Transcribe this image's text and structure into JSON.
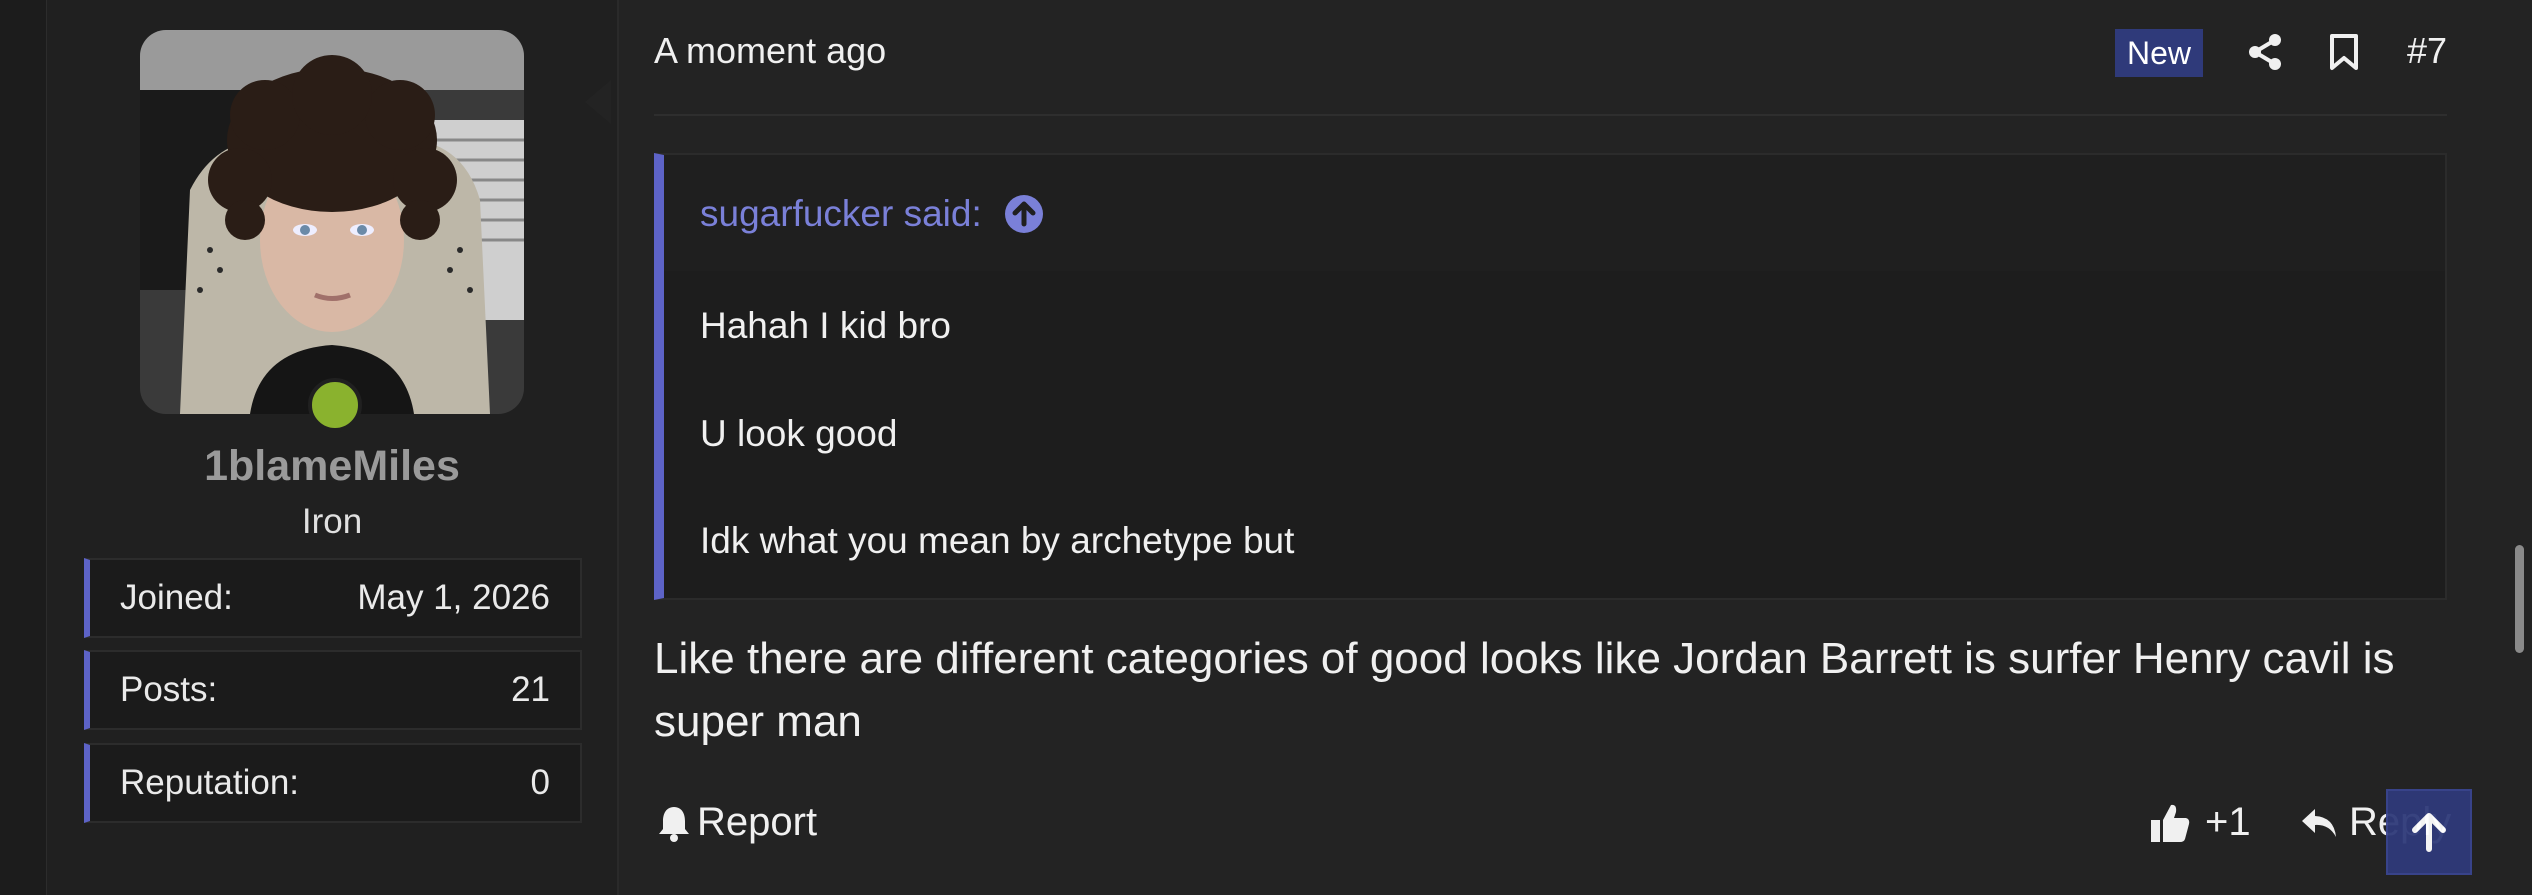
{
  "user": {
    "name": "1blameMiles",
    "rank": "Iron",
    "online": true,
    "stats": [
      {
        "label": "Joined:",
        "value": "May 1, 2026"
      },
      {
        "label": "Posts:",
        "value": "21"
      },
      {
        "label": "Reputation:",
        "value": "0"
      }
    ]
  },
  "post": {
    "time": "A moment ago",
    "badge": "New",
    "number": "#7",
    "quote": {
      "author": "sugarfucker said:",
      "lines": [
        "Hahah I kid bro",
        "U look good",
        "Idk what you mean by archetype but"
      ]
    },
    "body": "Like there are different categories of good looks like Jordan Barrett is surfer Henry cavil is super man",
    "actions": {
      "report": "Report",
      "like_count": "+1",
      "reply": "Reply"
    }
  },
  "icons": {
    "share": "share-icon",
    "bookmark": "bookmark-icon",
    "bell": "bell-icon",
    "thumbs_up": "thumbs-up-icon",
    "reply": "reply-icon",
    "arrow_up": "arrow-up-icon"
  },
  "colors": {
    "accent": "#5d63c7",
    "badge": "#2f3a7a",
    "online": "#8ab22e",
    "quote_author": "#7a80d8"
  }
}
